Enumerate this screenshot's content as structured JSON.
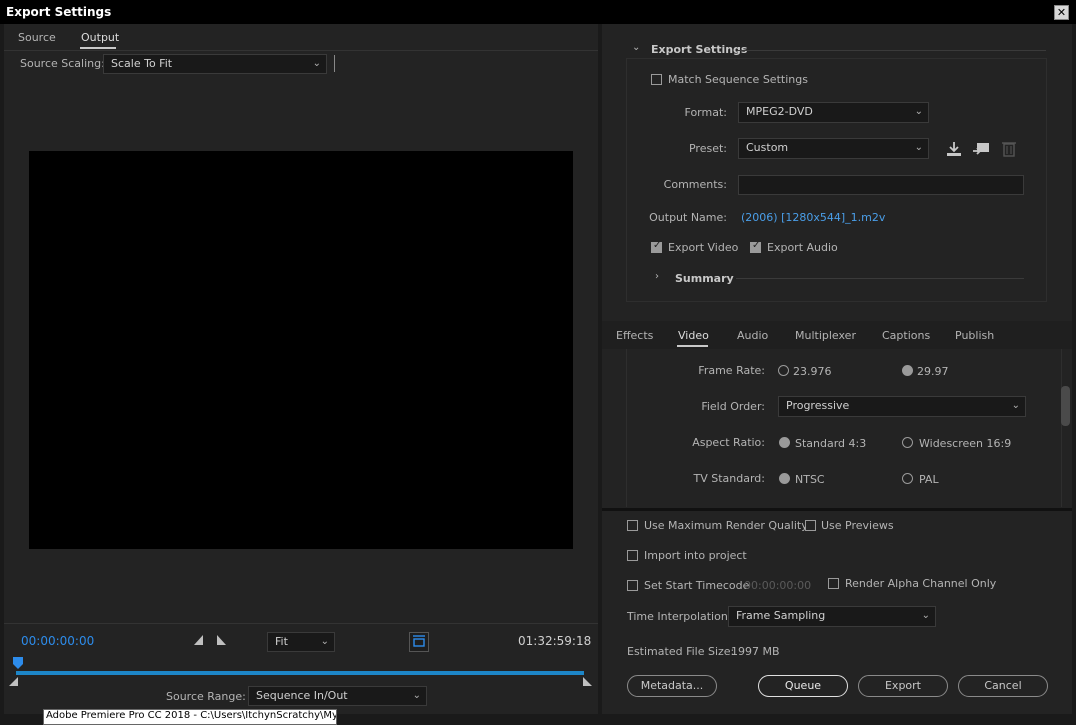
{
  "window": {
    "title": "Export Settings",
    "close_glyph": "✕"
  },
  "left": {
    "tabs": [
      {
        "label": "Source"
      },
      {
        "label": "Output"
      }
    ],
    "source_scaling": {
      "label": "Source Scaling:",
      "value": "Scale To Fit"
    },
    "timecode_start": "00:00:00:00",
    "timecode_end": "01:32:59:18",
    "zoom": {
      "value": "Fit"
    },
    "source_range": {
      "label": "Source Range:",
      "value": "Sequence In/Out"
    },
    "tooltip": "Adobe Premiere Pro CC 2018 - C:\\Users\\ItchynScratchy\\My"
  },
  "export_settings": {
    "header": "Export Settings",
    "match_sequence": {
      "label": "Match Sequence Settings",
      "checked": false
    },
    "format": {
      "label": "Format:",
      "value": "MPEG2-DVD"
    },
    "preset": {
      "label": "Preset:",
      "value": "Custom"
    },
    "comments": {
      "label": "Comments:",
      "value": ""
    },
    "output_name": {
      "label": "Output Name:",
      "value": "(2006) [1280x544]_1.m2v"
    },
    "export_video": {
      "label": "Export Video",
      "checked": true
    },
    "export_audio": {
      "label": "Export Audio",
      "checked": true
    },
    "summary": "Summary"
  },
  "settings_tabs": [
    {
      "label": "Effects"
    },
    {
      "label": "Video"
    },
    {
      "label": "Audio"
    },
    {
      "label": "Multiplexer"
    },
    {
      "label": "Captions"
    },
    {
      "label": "Publish"
    }
  ],
  "video": {
    "frame_rate": {
      "label": "Frame Rate:",
      "options": [
        "23.976",
        "29.97"
      ],
      "selected": "29.97"
    },
    "field_order": {
      "label": "Field Order:",
      "value": "Progressive"
    },
    "aspect_ratio": {
      "label": "Aspect Ratio:",
      "options": [
        "Standard 4:3",
        "Widescreen 16:9"
      ],
      "selected": "Standard 4:3"
    },
    "tv_standard": {
      "label": "TV Standard:",
      "options": [
        "NTSC",
        "PAL"
      ],
      "selected": "NTSC"
    }
  },
  "bottom": {
    "max_render_quality": {
      "label": "Use Maximum Render Quality",
      "checked": false
    },
    "use_previews": {
      "label": "Use Previews",
      "checked": false
    },
    "import_project": {
      "label": "Import into project",
      "checked": false
    },
    "start_timecode": {
      "label": "Set Start Timecode",
      "value": "00:00:00:00",
      "checked": false
    },
    "render_alpha": {
      "label": "Render Alpha Channel Only",
      "checked": false
    },
    "time_interpolation": {
      "label": "Time Interpolation:",
      "value": "Frame Sampling"
    },
    "file_size": {
      "label": "Estimated File Size:",
      "value": "1997 MB"
    },
    "buttons": {
      "metadata": "Metadata...",
      "queue": "Queue",
      "export": "Export",
      "cancel": "Cancel"
    }
  },
  "colors": {
    "accent": "#2d8ceb",
    "link": "#4a9ee8",
    "panel": "#232323",
    "window": "#1a1a1a"
  }
}
